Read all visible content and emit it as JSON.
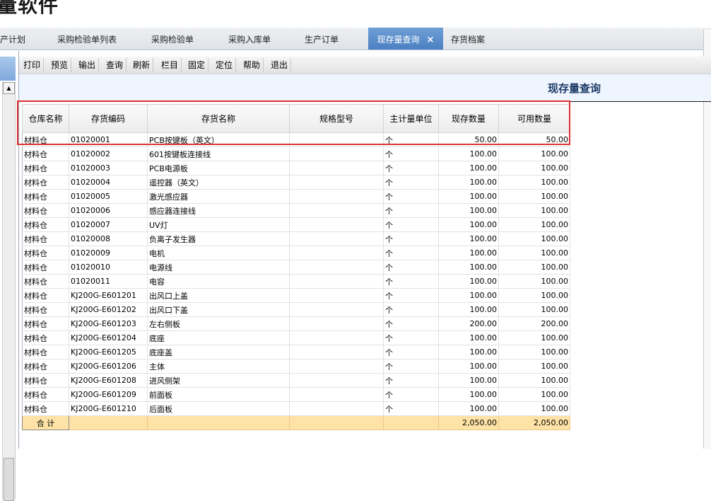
{
  "app_title": "量软件",
  "tabs": [
    {
      "label": "产计划"
    },
    {
      "label": "采购检验单列表"
    },
    {
      "label": "采购检验单"
    },
    {
      "label": "采购入库单"
    },
    {
      "label": "生产订单"
    },
    {
      "label": "现存量查询",
      "active": true
    },
    {
      "label": "存货档案"
    }
  ],
  "close_icon": "×",
  "toolbar": [
    "打印",
    "预览",
    "输出",
    "查询",
    "刷新",
    "栏目",
    "固定",
    "定位",
    "帮助",
    "退出"
  ],
  "report_title": "现存量查询",
  "columns": [
    "仓库名称",
    "存货编码",
    "存货名称",
    "规格型号",
    "主计量单位",
    "现存数量",
    "可用数量"
  ],
  "rows": [
    [
      "材料仓",
      "01020001",
      "PCB按键板（英文）",
      "",
      "个",
      "50.00",
      "50.00"
    ],
    [
      "材料仓",
      "01020002",
      "601按键板连接线",
      "",
      "个",
      "100.00",
      "100.00"
    ],
    [
      "材料仓",
      "01020003",
      "PCB电源板",
      "",
      "个",
      "100.00",
      "100.00"
    ],
    [
      "材料仓",
      "01020004",
      "遥控器（英文）",
      "",
      "个",
      "100.00",
      "100.00"
    ],
    [
      "材料仓",
      "01020005",
      "激光感应器",
      "",
      "个",
      "100.00",
      "100.00"
    ],
    [
      "材料仓",
      "01020006",
      "感应器连接线",
      "",
      "个",
      "100.00",
      "100.00"
    ],
    [
      "材料仓",
      "01020007",
      "UV灯",
      "",
      "个",
      "100.00",
      "100.00"
    ],
    [
      "材料仓",
      "01020008",
      "负离子发生器",
      "",
      "个",
      "100.00",
      "100.00"
    ],
    [
      "材料仓",
      "01020009",
      "电机",
      "",
      "个",
      "100.00",
      "100.00"
    ],
    [
      "材料仓",
      "01020010",
      "电源线",
      "",
      "个",
      "100.00",
      "100.00"
    ],
    [
      "材料仓",
      "01020011",
      "电容",
      "",
      "个",
      "100.00",
      "100.00"
    ],
    [
      "材料仓",
      "KJ200G-E601201",
      "出风口上盖",
      "",
      "个",
      "100.00",
      "100.00"
    ],
    [
      "材料仓",
      "KJ200G-E601202",
      "出风口下盖",
      "",
      "个",
      "100.00",
      "100.00"
    ],
    [
      "材料仓",
      "KJ200G-E601203",
      "左右侧板",
      "",
      "个",
      "200.00",
      "200.00"
    ],
    [
      "材料仓",
      "KJ200G-E601204",
      "底座",
      "",
      "个",
      "100.00",
      "100.00"
    ],
    [
      "材料仓",
      "KJ200G-E601205",
      "底座盖",
      "",
      "个",
      "100.00",
      "100.00"
    ],
    [
      "材料仓",
      "KJ200G-E601206",
      "主体",
      "",
      "个",
      "100.00",
      "100.00"
    ],
    [
      "材料仓",
      "KJ200G-E601208",
      "进风侧架",
      "",
      "个",
      "100.00",
      "100.00"
    ],
    [
      "材料仓",
      "KJ200G-E601209",
      "前面板",
      "",
      "个",
      "100.00",
      "100.00"
    ],
    [
      "材料仓",
      "KJ200G-E601210",
      "后面板",
      "",
      "个",
      "100.00",
      "100.00"
    ]
  ],
  "total": {
    "label": "合 计",
    "current_qty": "2,050.00",
    "available_qty": "2,050.00"
  },
  "colors": {
    "highlight_border": "#e03030",
    "total_row": "#ffe3a6",
    "active_tab": "#5b8ccb"
  }
}
